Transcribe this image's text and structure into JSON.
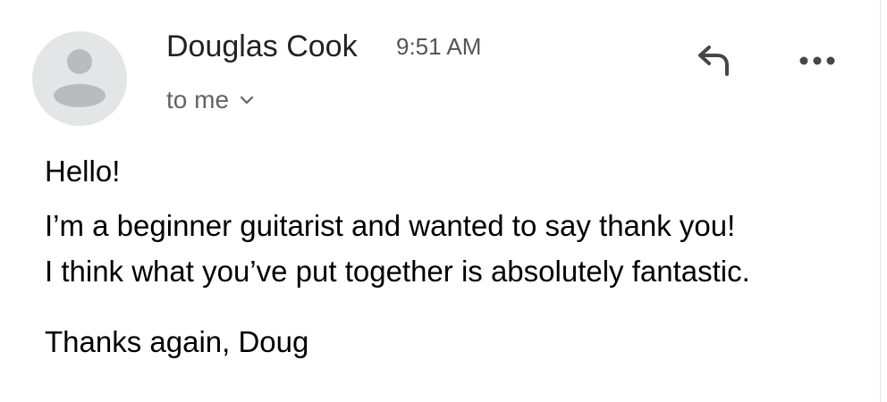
{
  "header": {
    "sender_name": "Douglas Cook",
    "time": "9:51 AM",
    "recipient_label": "to me",
    "icons": {
      "avatar": "person-avatar-icon",
      "recipient_details": "chevron-down-icon",
      "reply": "reply-icon",
      "more": "more-options-icon"
    }
  },
  "message": {
    "greeting": "Hello!",
    "line1": "I’m a beginner guitarist and wanted to say thank you!",
    "line2": "I think what you’ve put together is absolutely fantastic.",
    "signoff": "Thanks again, Doug"
  },
  "colors": {
    "avatar_bg": "#e4e5e7",
    "avatar_fg": "#b8bbbf",
    "secondary_text": "#5f6368",
    "icon": "#444746"
  }
}
